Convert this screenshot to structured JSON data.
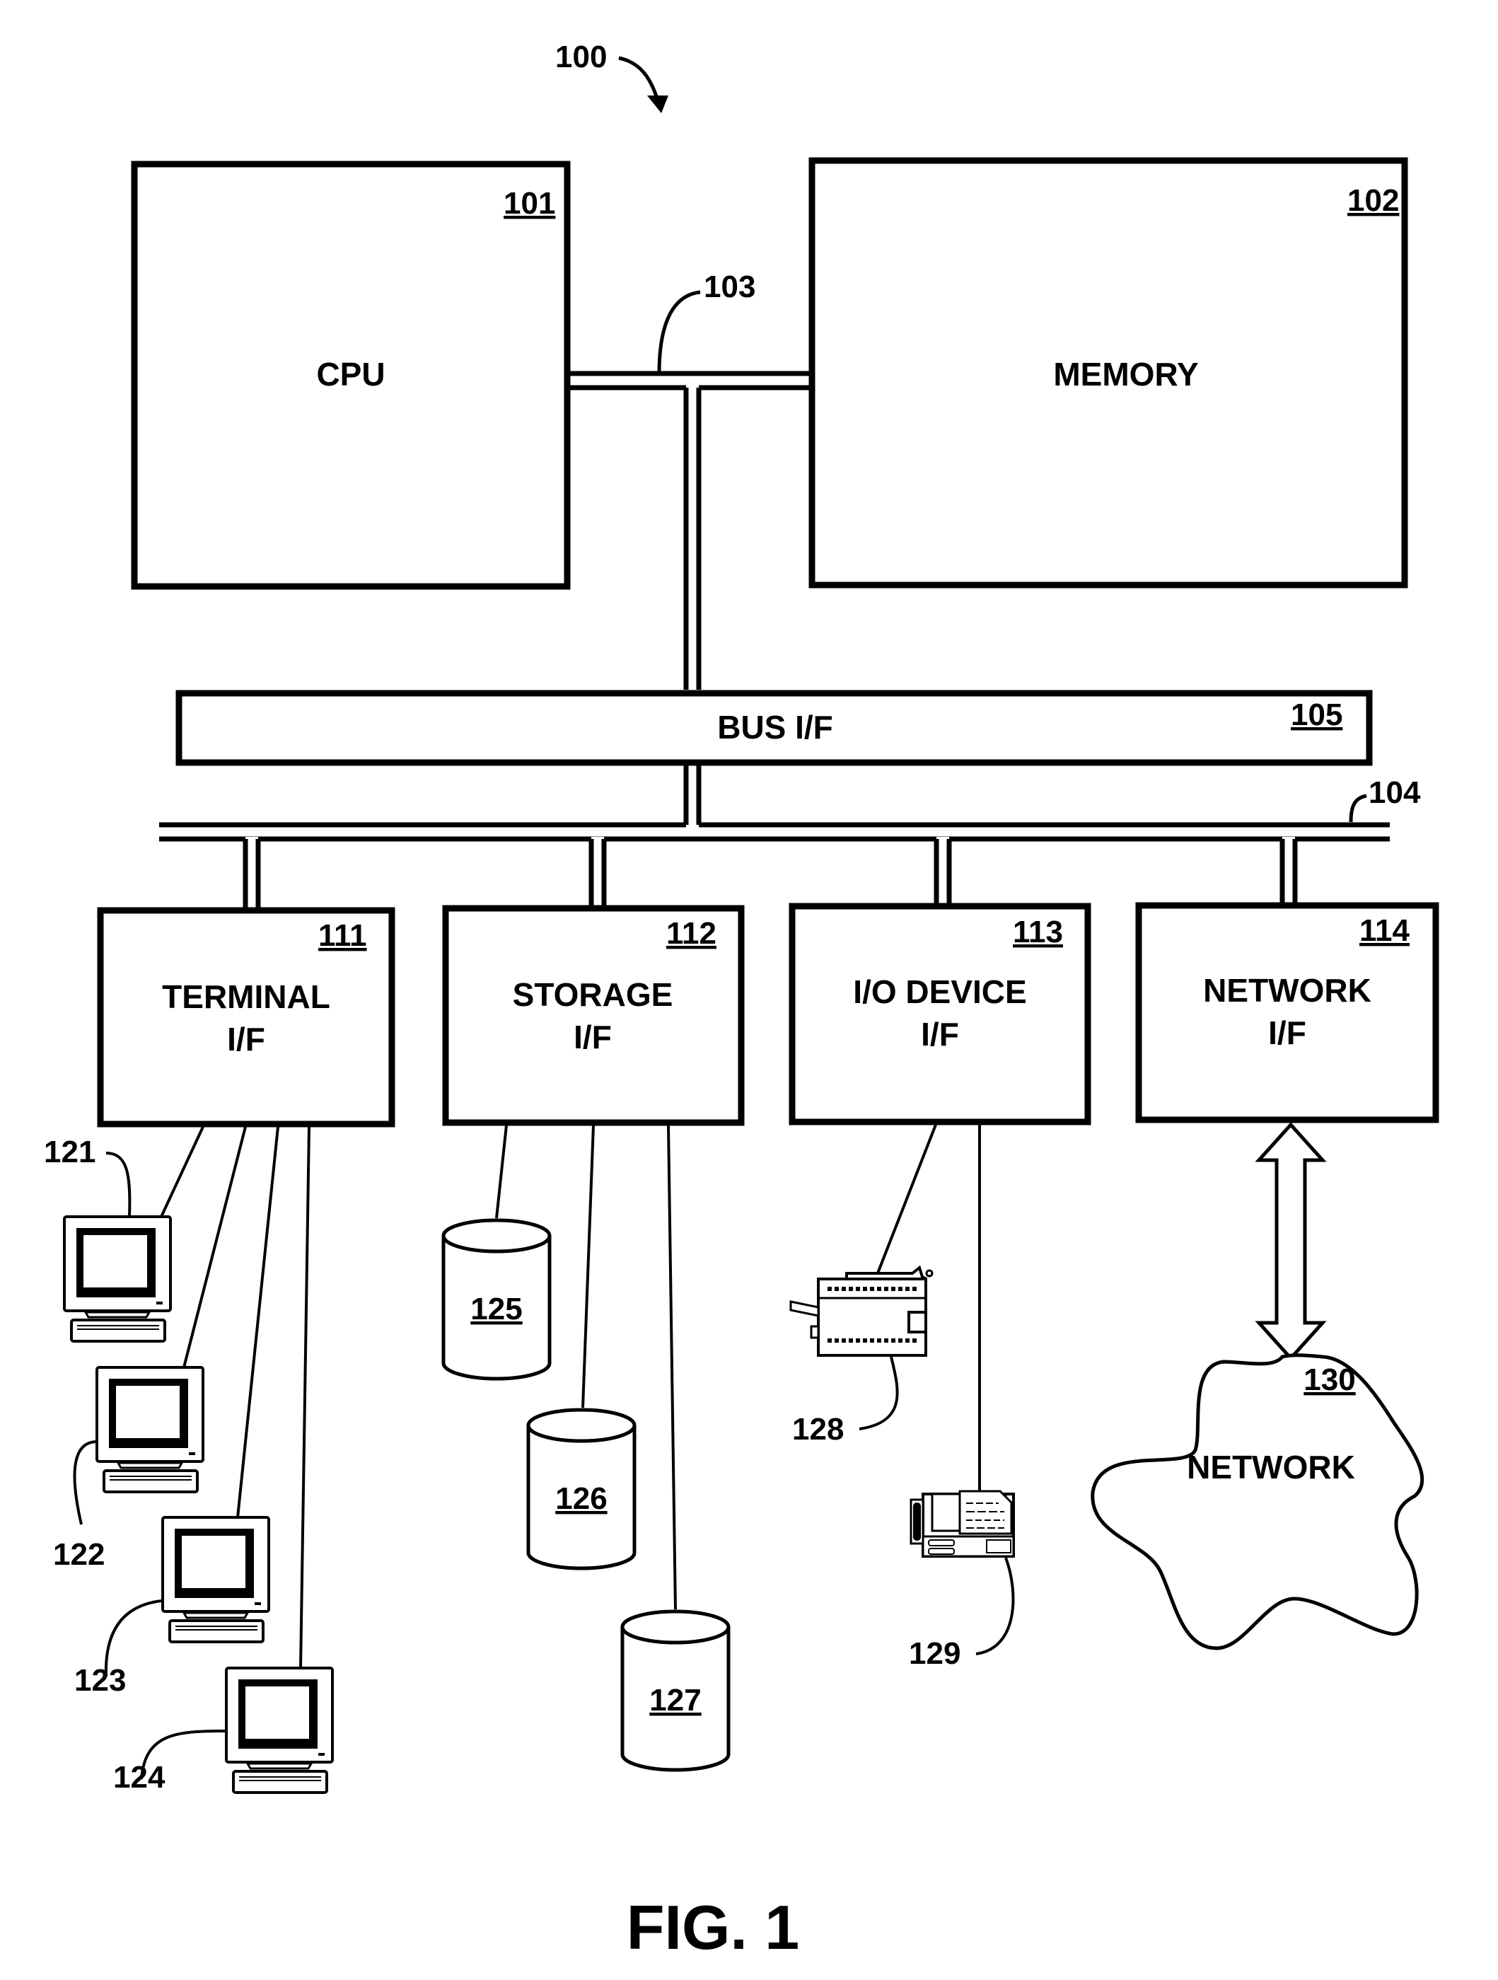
{
  "figure": {
    "ref": "100",
    "caption": "FIG. 1"
  },
  "cpu": {
    "ref": "101",
    "label": "CPU"
  },
  "memory": {
    "ref": "102",
    "label": "MEMORY"
  },
  "memory_bus": {
    "ref": "103"
  },
  "io_bus": {
    "ref": "104"
  },
  "bus_interface": {
    "ref": "105",
    "label": "BUS I/F"
  },
  "interfaces": [
    {
      "ref": "111",
      "line1": "TERMINAL",
      "line2": "I/F"
    },
    {
      "ref": "112",
      "line1": "STORAGE",
      "line2": "I/F"
    },
    {
      "ref": "113",
      "line1": "I/O DEVICE",
      "line2": "I/F"
    },
    {
      "ref": "114",
      "line1": "NETWORK",
      "line2": "I/F"
    }
  ],
  "terminals": [
    {
      "ref": "121"
    },
    {
      "ref": "122"
    },
    {
      "ref": "123"
    },
    {
      "ref": "124"
    }
  ],
  "storage_devices": [
    {
      "ref": "125"
    },
    {
      "ref": "126"
    },
    {
      "ref": "127"
    }
  ],
  "io_devices": [
    {
      "ref": "128",
      "kind": "printer"
    },
    {
      "ref": "129",
      "kind": "fax-machine"
    }
  ],
  "network": {
    "ref": "130",
    "label": "NETWORK"
  }
}
